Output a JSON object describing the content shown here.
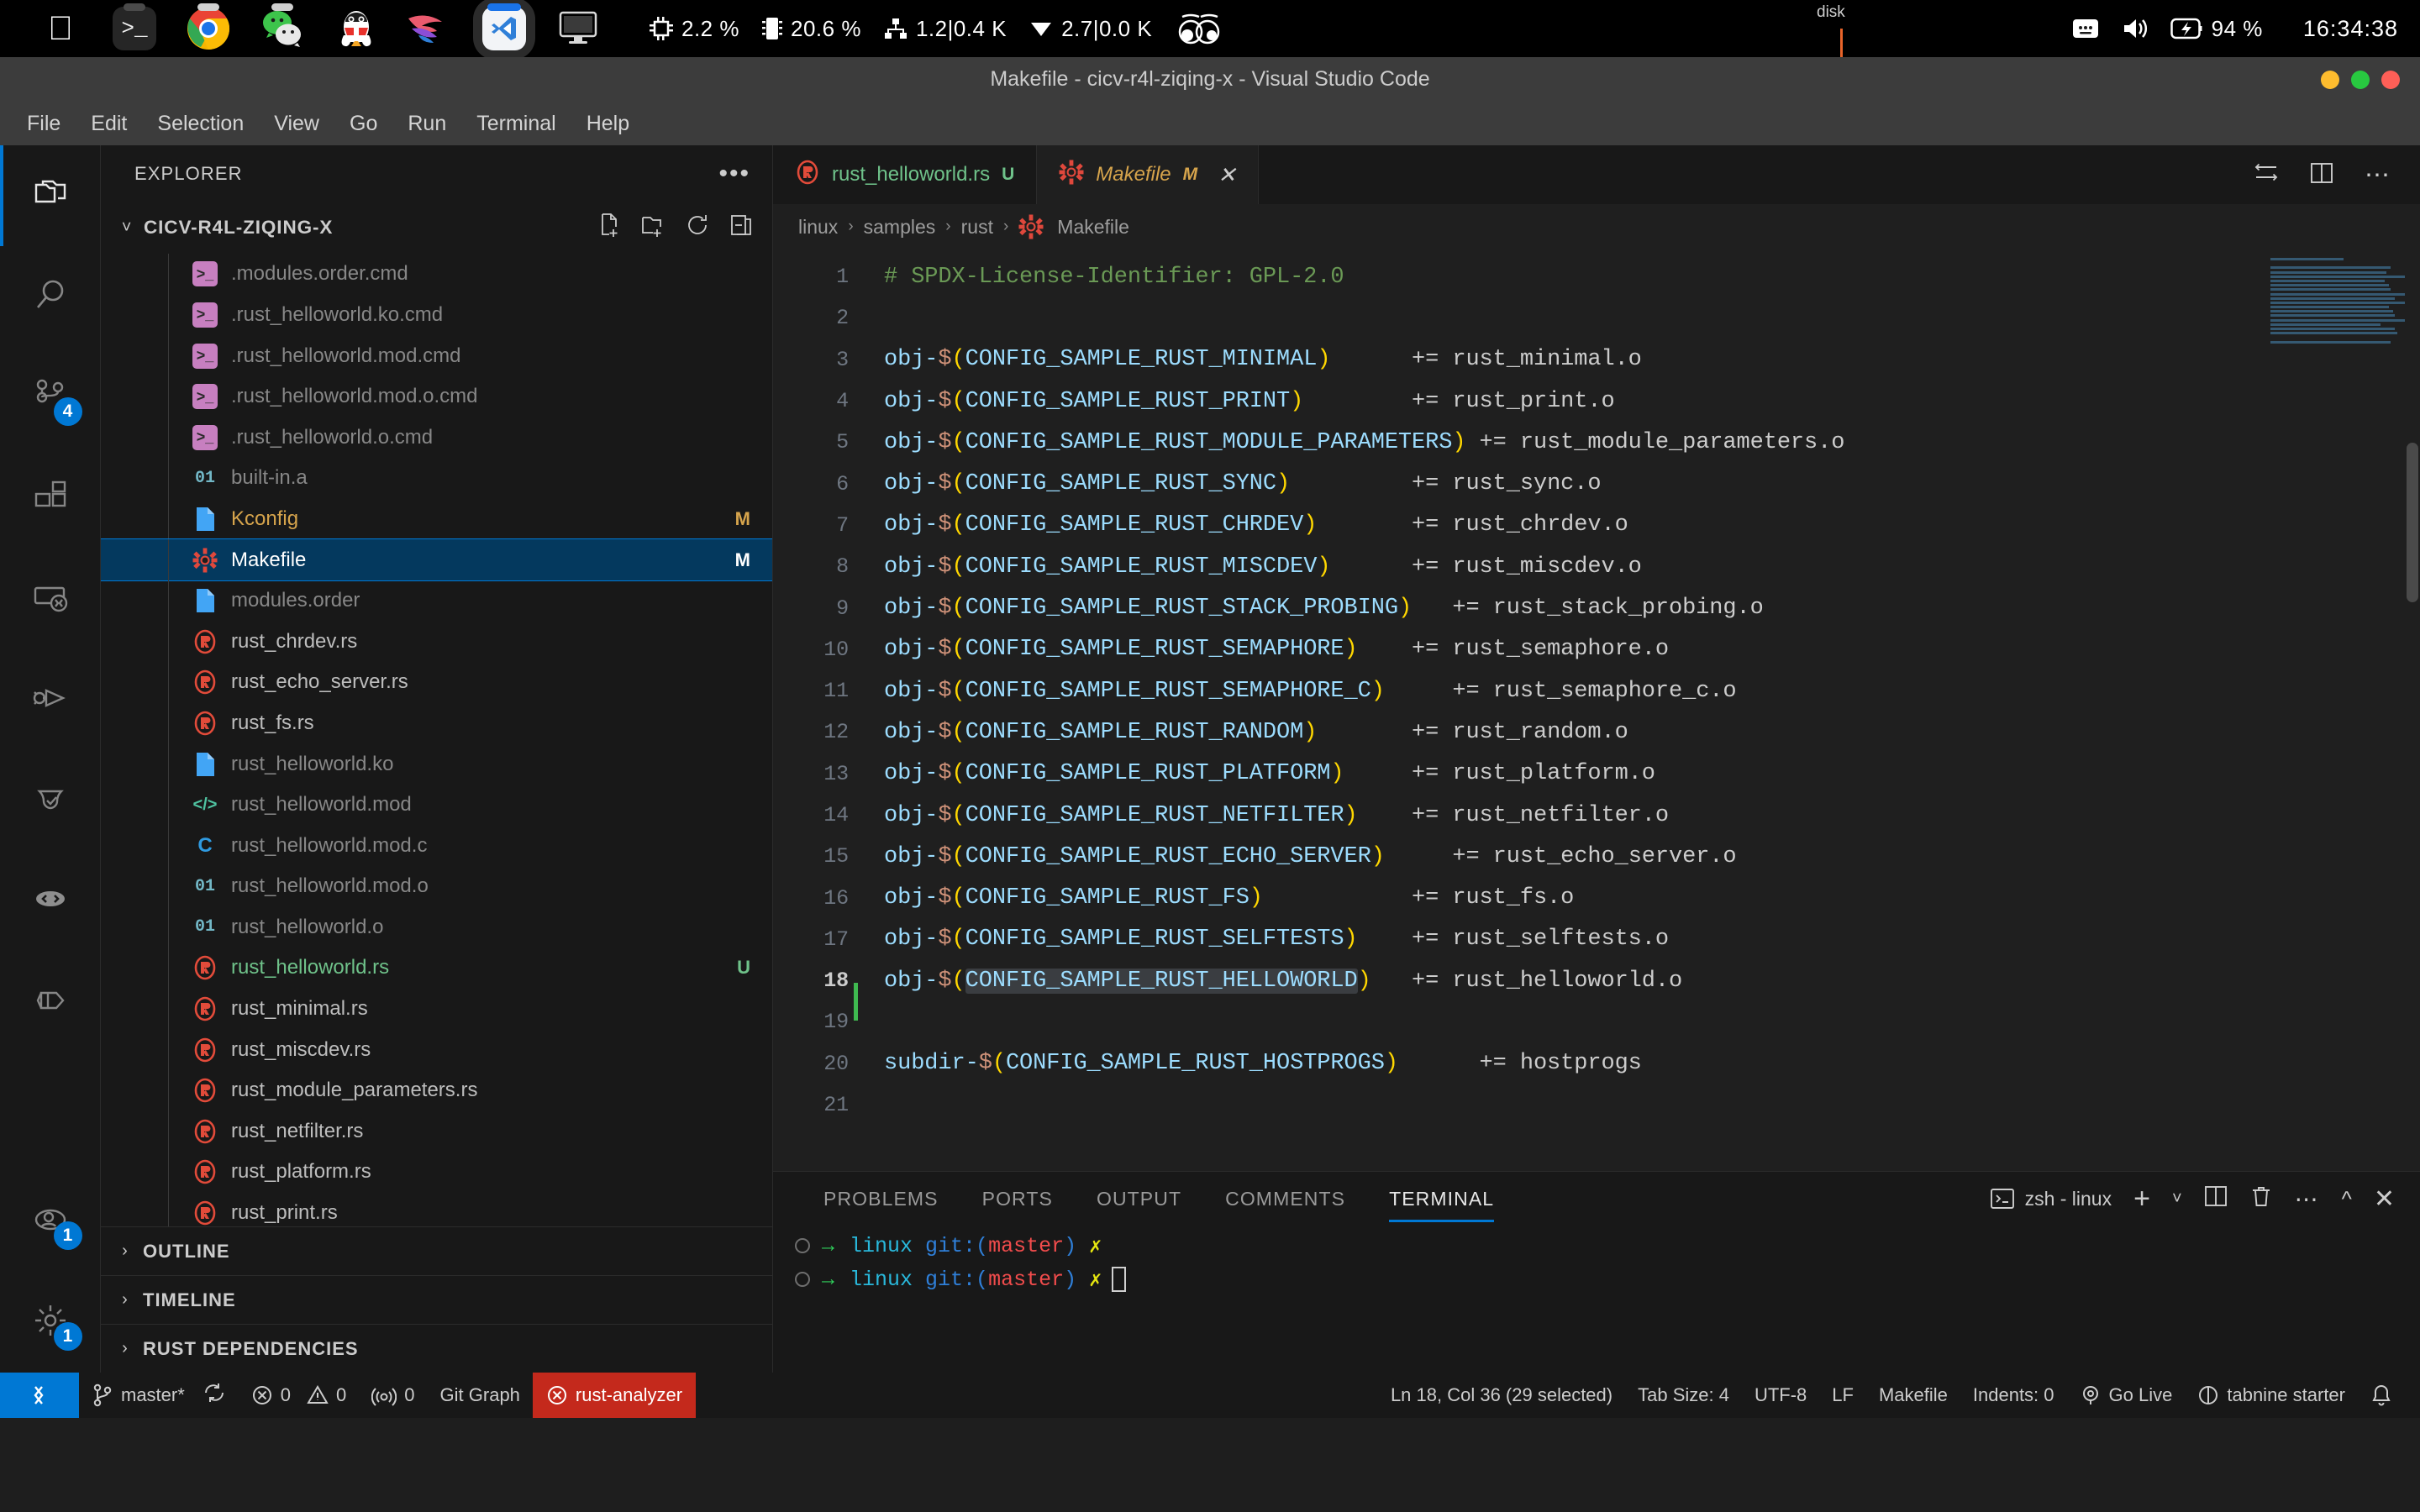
{
  "macbar": {
    "dock": [
      {
        "name": "apple-menu-icon",
        "label": "apple"
      },
      {
        "name": "terminal-app-icon",
        "label": "terminal"
      },
      {
        "name": "chrome-app-icon",
        "label": "chrome"
      },
      {
        "name": "wechat-app-icon",
        "label": "wechat"
      },
      {
        "name": "qq-app-icon",
        "label": "qq"
      },
      {
        "name": "warp-app-icon",
        "label": "warp"
      },
      {
        "name": "vscode-app-icon",
        "label": "vscode"
      },
      {
        "name": "display-icon",
        "label": "display"
      }
    ],
    "cpu": "2.2 %",
    "memory": "20.6 %",
    "network_down": "1.2|0.4 K",
    "network_up": "2.7|0.0 K",
    "disk_label": "disk",
    "battery": "94 %",
    "clock": "16:34:38"
  },
  "window": {
    "title": "Makefile - cicv-r4l-ziqing-x - Visual Studio Code"
  },
  "menubar": {
    "items": [
      "File",
      "Edit",
      "Selection",
      "View",
      "Go",
      "Run",
      "Terminal",
      "Help"
    ]
  },
  "activitybar": {
    "items": [
      {
        "name": "explorer",
        "icon": "files-icon",
        "badge": null,
        "active": true
      },
      {
        "name": "search",
        "icon": "search-icon",
        "badge": null,
        "active": false
      },
      {
        "name": "source-control",
        "icon": "source-control-icon",
        "badge": "4",
        "active": false
      },
      {
        "name": "extensions",
        "icon": "extensions-icon",
        "badge": null,
        "active": false
      },
      {
        "name": "remote-explorer",
        "icon": "remote-icon",
        "badge": null,
        "active": false
      },
      {
        "name": "run-and-debug",
        "icon": "debug-icon",
        "badge": null,
        "active": false
      },
      {
        "name": "testing",
        "icon": "beaker-icon",
        "badge": null,
        "active": false
      },
      {
        "name": "live-share",
        "icon": "live-share-icon",
        "badge": null,
        "active": false
      },
      {
        "name": "container-view",
        "icon": "cube-icon",
        "badge": null,
        "active": false
      }
    ],
    "bottom": [
      {
        "name": "accounts",
        "icon": "account-icon",
        "badge": "1"
      },
      {
        "name": "manage",
        "icon": "gear-icon",
        "badge": "1"
      }
    ]
  },
  "sidebar": {
    "header": "EXPLORER",
    "more_label": "•••",
    "folder": "CICV-R4L-ZIQING-X",
    "folder_actions": [
      "new-file-icon",
      "new-folder-icon",
      "refresh-icon",
      "collapse-all-icon"
    ],
    "files": [
      {
        "name": ".modules.order.cmd",
        "icon": "cmd",
        "state": "dim",
        "badge": ""
      },
      {
        "name": ".rust_helloworld.ko.cmd",
        "icon": "cmd",
        "state": "dim",
        "badge": ""
      },
      {
        "name": ".rust_helloworld.mod.cmd",
        "icon": "cmd",
        "state": "dim",
        "badge": ""
      },
      {
        "name": ".rust_helloworld.mod.o.cmd",
        "icon": "cmd",
        "state": "dim",
        "badge": ""
      },
      {
        "name": ".rust_helloworld.o.cmd",
        "icon": "cmd",
        "state": "dim",
        "badge": ""
      },
      {
        "name": "built-in.a",
        "icon": "bin",
        "state": "dim",
        "badge": ""
      },
      {
        "name": "Kconfig",
        "icon": "file",
        "state": "mod",
        "badge": "M"
      },
      {
        "name": "Makefile",
        "icon": "make",
        "state": "selected",
        "badge": "M"
      },
      {
        "name": "modules.order",
        "icon": "file",
        "state": "dim",
        "badge": ""
      },
      {
        "name": "rust_chrdev.rs",
        "icon": "rust",
        "state": "normal",
        "badge": ""
      },
      {
        "name": "rust_echo_server.rs",
        "icon": "rust",
        "state": "normal",
        "badge": ""
      },
      {
        "name": "rust_fs.rs",
        "icon": "rust",
        "state": "normal",
        "badge": ""
      },
      {
        "name": "rust_helloworld.ko",
        "icon": "file",
        "state": "dim",
        "badge": ""
      },
      {
        "name": "rust_helloworld.mod",
        "icon": "code",
        "state": "dim",
        "badge": ""
      },
      {
        "name": "rust_helloworld.mod.c",
        "icon": "c",
        "state": "dim",
        "badge": ""
      },
      {
        "name": "rust_helloworld.mod.o",
        "icon": "bin",
        "state": "dim",
        "badge": ""
      },
      {
        "name": "rust_helloworld.o",
        "icon": "bin",
        "state": "dim",
        "badge": ""
      },
      {
        "name": "rust_helloworld.rs",
        "icon": "rust",
        "state": "untracked",
        "badge": "U"
      },
      {
        "name": "rust_minimal.rs",
        "icon": "rust",
        "state": "normal",
        "badge": ""
      },
      {
        "name": "rust_miscdev.rs",
        "icon": "rust",
        "state": "normal",
        "badge": ""
      },
      {
        "name": "rust_module_parameters.rs",
        "icon": "rust",
        "state": "normal",
        "badge": ""
      },
      {
        "name": "rust_netfilter.rs",
        "icon": "rust",
        "state": "normal",
        "badge": ""
      },
      {
        "name": "rust_platform.rs",
        "icon": "rust",
        "state": "normal",
        "badge": ""
      },
      {
        "name": "rust_print.rs",
        "icon": "rust",
        "state": "normal",
        "badge": ""
      }
    ],
    "sections": [
      "OUTLINE",
      "TIMELINE",
      "RUST DEPENDENCIES"
    ]
  },
  "editor": {
    "tabs": [
      {
        "label": "rust_helloworld.rs",
        "badge": "U",
        "icon": "rust-icon",
        "active": false,
        "closable": false
      },
      {
        "label": "Makefile",
        "badge": "M",
        "icon": "gear-icon",
        "active": true,
        "closable": true
      }
    ],
    "tab_actions": [
      "split-editor-right-icon",
      "open-changes-icon",
      "more-actions-icon"
    ],
    "breadcrumb": [
      "linux",
      "samples",
      "rust",
      "Makefile"
    ],
    "breadcrumb_sep": "›",
    "lines": [
      {
        "n": "1",
        "tokens": [
          {
            "t": "# SPDX-License-Identifier: GPL-2.0",
            "c": "cmt"
          }
        ]
      },
      {
        "n": "2",
        "tokens": []
      },
      {
        "n": "3",
        "tokens": [
          {
            "t": "obj-",
            "c": "var"
          },
          {
            "t": "$",
            "c": "dollar"
          },
          {
            "t": "(",
            "c": "paren"
          },
          {
            "t": "CONFIG_SAMPLE_RUST_MINIMAL",
            "c": "var"
          },
          {
            "t": ")",
            "c": "paren"
          },
          {
            "t": "      += rust_minimal.o",
            "c": "plain"
          }
        ]
      },
      {
        "n": "4",
        "tokens": [
          {
            "t": "obj-",
            "c": "var"
          },
          {
            "t": "$",
            "c": "dollar"
          },
          {
            "t": "(",
            "c": "paren"
          },
          {
            "t": "CONFIG_SAMPLE_RUST_PRINT",
            "c": "var"
          },
          {
            "t": ")",
            "c": "paren"
          },
          {
            "t": "        += rust_print.o",
            "c": "plain"
          }
        ]
      },
      {
        "n": "5",
        "tokens": [
          {
            "t": "obj-",
            "c": "var"
          },
          {
            "t": "$",
            "c": "dollar"
          },
          {
            "t": "(",
            "c": "paren"
          },
          {
            "t": "CONFIG_SAMPLE_RUST_MODULE_PARAMETERS",
            "c": "var"
          },
          {
            "t": ")",
            "c": "paren"
          },
          {
            "t": " += rust_module_parameters.o",
            "c": "plain"
          }
        ]
      },
      {
        "n": "6",
        "tokens": [
          {
            "t": "obj-",
            "c": "var"
          },
          {
            "t": "$",
            "c": "dollar"
          },
          {
            "t": "(",
            "c": "paren"
          },
          {
            "t": "CONFIG_SAMPLE_RUST_SYNC",
            "c": "var"
          },
          {
            "t": ")",
            "c": "paren"
          },
          {
            "t": "         += rust_sync.o",
            "c": "plain"
          }
        ]
      },
      {
        "n": "7",
        "tokens": [
          {
            "t": "obj-",
            "c": "var"
          },
          {
            "t": "$",
            "c": "dollar"
          },
          {
            "t": "(",
            "c": "paren"
          },
          {
            "t": "CONFIG_SAMPLE_RUST_CHRDEV",
            "c": "var"
          },
          {
            "t": ")",
            "c": "paren"
          },
          {
            "t": "       += rust_chrdev.o",
            "c": "plain"
          }
        ]
      },
      {
        "n": "8",
        "tokens": [
          {
            "t": "obj-",
            "c": "var"
          },
          {
            "t": "$",
            "c": "dollar"
          },
          {
            "t": "(",
            "c": "paren"
          },
          {
            "t": "CONFIG_SAMPLE_RUST_MISCDEV",
            "c": "var"
          },
          {
            "t": ")",
            "c": "paren"
          },
          {
            "t": "      += rust_miscdev.o",
            "c": "plain"
          }
        ]
      },
      {
        "n": "9",
        "tokens": [
          {
            "t": "obj-",
            "c": "var"
          },
          {
            "t": "$",
            "c": "dollar"
          },
          {
            "t": "(",
            "c": "paren"
          },
          {
            "t": "CONFIG_SAMPLE_RUST_STACK_PROBING",
            "c": "var"
          },
          {
            "t": ")",
            "c": "paren"
          },
          {
            "t": "   += rust_stack_probing.o",
            "c": "plain"
          }
        ]
      },
      {
        "n": "10",
        "tokens": [
          {
            "t": "obj-",
            "c": "var"
          },
          {
            "t": "$",
            "c": "dollar"
          },
          {
            "t": "(",
            "c": "paren"
          },
          {
            "t": "CONFIG_SAMPLE_RUST_SEMAPHORE",
            "c": "var"
          },
          {
            "t": ")",
            "c": "paren"
          },
          {
            "t": "    += rust_semaphore.o",
            "c": "plain"
          }
        ]
      },
      {
        "n": "11",
        "tokens": [
          {
            "t": "obj-",
            "c": "var"
          },
          {
            "t": "$",
            "c": "dollar"
          },
          {
            "t": "(",
            "c": "paren"
          },
          {
            "t": "CONFIG_SAMPLE_RUST_SEMAPHORE_C",
            "c": "var"
          },
          {
            "t": ")",
            "c": "paren"
          },
          {
            "t": "     += rust_semaphore_c.o",
            "c": "plain"
          }
        ]
      },
      {
        "n": "12",
        "tokens": [
          {
            "t": "obj-",
            "c": "var"
          },
          {
            "t": "$",
            "c": "dollar"
          },
          {
            "t": "(",
            "c": "paren"
          },
          {
            "t": "CONFIG_SAMPLE_RUST_RANDOM",
            "c": "var"
          },
          {
            "t": ")",
            "c": "paren"
          },
          {
            "t": "       += rust_random.o",
            "c": "plain"
          }
        ]
      },
      {
        "n": "13",
        "tokens": [
          {
            "t": "obj-",
            "c": "var"
          },
          {
            "t": "$",
            "c": "dollar"
          },
          {
            "t": "(",
            "c": "paren"
          },
          {
            "t": "CONFIG_SAMPLE_RUST_PLATFORM",
            "c": "var"
          },
          {
            "t": ")",
            "c": "paren"
          },
          {
            "t": "     += rust_platform.o",
            "c": "plain"
          }
        ]
      },
      {
        "n": "14",
        "tokens": [
          {
            "t": "obj-",
            "c": "var"
          },
          {
            "t": "$",
            "c": "dollar"
          },
          {
            "t": "(",
            "c": "paren"
          },
          {
            "t": "CONFIG_SAMPLE_RUST_NETFILTER",
            "c": "var"
          },
          {
            "t": ")",
            "c": "paren"
          },
          {
            "t": "    += rust_netfilter.o",
            "c": "plain"
          }
        ]
      },
      {
        "n": "15",
        "tokens": [
          {
            "t": "obj-",
            "c": "var"
          },
          {
            "t": "$",
            "c": "dollar"
          },
          {
            "t": "(",
            "c": "paren"
          },
          {
            "t": "CONFIG_SAMPLE_RUST_ECHO_SERVER",
            "c": "var"
          },
          {
            "t": ")",
            "c": "paren"
          },
          {
            "t": "     += rust_echo_server.o",
            "c": "plain"
          }
        ]
      },
      {
        "n": "16",
        "tokens": [
          {
            "t": "obj-",
            "c": "var"
          },
          {
            "t": "$",
            "c": "dollar"
          },
          {
            "t": "(",
            "c": "paren"
          },
          {
            "t": "CONFIG_SAMPLE_RUST_FS",
            "c": "var"
          },
          {
            "t": ")",
            "c": "paren"
          },
          {
            "t": "           += rust_fs.o",
            "c": "plain"
          }
        ]
      },
      {
        "n": "17",
        "tokens": [
          {
            "t": "obj-",
            "c": "var"
          },
          {
            "t": "$",
            "c": "dollar"
          },
          {
            "t": "(",
            "c": "paren"
          },
          {
            "t": "CONFIG_SAMPLE_RUST_SELFTESTS",
            "c": "var"
          },
          {
            "t": ")",
            "c": "paren"
          },
          {
            "t": "    += rust_selftests.o",
            "c": "plain"
          }
        ]
      },
      {
        "n": "18",
        "current": true,
        "modified": true,
        "tokens": [
          {
            "t": "obj-",
            "c": "var"
          },
          {
            "t": "$",
            "c": "dollar"
          },
          {
            "t": "(",
            "c": "paren"
          },
          {
            "t": "CONFIG_SAMPLE_RUST_HELLOWORLD",
            "c": "var",
            "sel": true
          },
          {
            "t": ")",
            "c": "paren"
          },
          {
            "t": "   += rust_helloworld.o",
            "c": "plain"
          }
        ]
      },
      {
        "n": "19",
        "tokens": []
      },
      {
        "n": "20",
        "tokens": [
          {
            "t": "subdir-",
            "c": "var"
          },
          {
            "t": "$",
            "c": "dollar"
          },
          {
            "t": "(",
            "c": "paren"
          },
          {
            "t": "CONFIG_SAMPLE_RUST_HOSTPROGS",
            "c": "var"
          },
          {
            "t": ")",
            "c": "paren"
          },
          {
            "t": "      += hostprogs",
            "c": "plain"
          }
        ]
      },
      {
        "n": "21",
        "tokens": []
      }
    ]
  },
  "panel": {
    "tabs": [
      "PROBLEMS",
      "PORTS",
      "OUTPUT",
      "COMMENTS",
      "TERMINAL"
    ],
    "active_tab": "TERMINAL",
    "terminal_name": "zsh - linux",
    "actions": [
      "new-terminal-icon",
      "terminal-dropdown-icon",
      "split-terminal-icon",
      "kill-terminal-icon",
      "more-actions-icon",
      "maximize-panel-icon",
      "close-panel-icon"
    ],
    "lines": [
      {
        "cwd": "linux",
        "git": "git:(",
        "branch": "master",
        "gitclose": ")",
        "dirty": "✗",
        "cursor": false
      },
      {
        "cwd": "linux",
        "git": "git:(",
        "branch": "master",
        "gitclose": ")",
        "dirty": "✗",
        "cursor": true
      }
    ]
  },
  "statusbar": {
    "remote_icon": "remote-window-icon",
    "branch": "master*",
    "sync_icon": "sync-icon",
    "errors": "0",
    "warnings": "0",
    "ports": "0",
    "git_graph": "Git Graph",
    "rust_analyzer": "rust-analyzer",
    "position": "Ln 18, Col 36 (29 selected)",
    "tab_size": "Tab Size: 4",
    "encoding": "UTF-8",
    "eol": "LF",
    "language": "Makefile",
    "indents": "Indents: 0",
    "go_live": "Go Live",
    "tabnine": "tabnine starter",
    "bell_icon": "bell-icon"
  },
  "colors": {
    "accent": "#0078d4",
    "selection": "#04395e",
    "error": "#c4291c",
    "modified": "#d6a44c",
    "untracked": "#6fc28a",
    "comment": "#6a9955",
    "variable": "#9cdcfe",
    "paren": "#ffd700"
  }
}
